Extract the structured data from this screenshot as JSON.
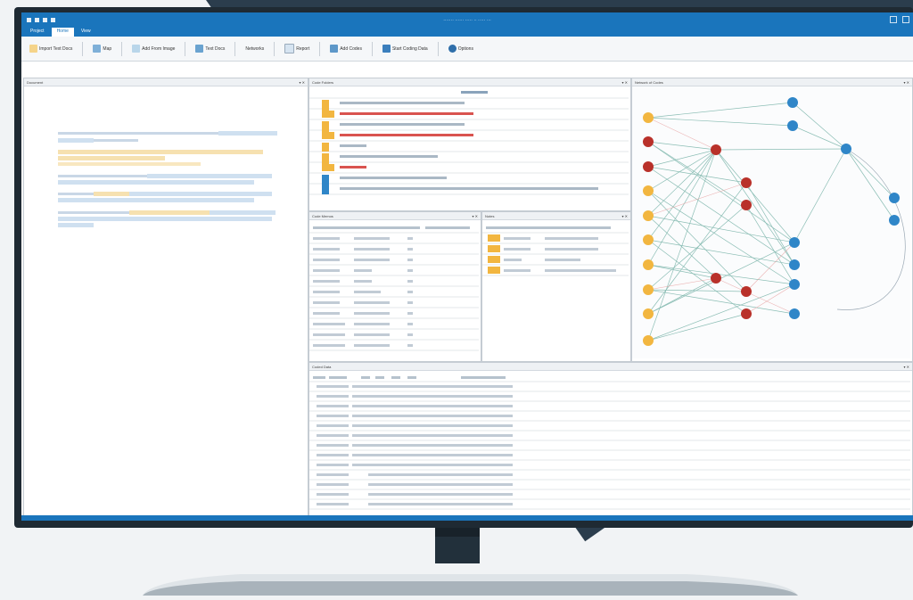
{
  "colors": {
    "accent": "#1a75bc",
    "node_yellow": "#f2b640",
    "node_red": "#b9312a",
    "node_blue": "#2f86c8",
    "highlight_blue": "#cfe0f0",
    "highlight_yellow": "#f6e1b0"
  },
  "window": {
    "title": "······· ······ ····· ·· ····· ···"
  },
  "menu": {
    "items": [
      "Project",
      "Home",
      "View"
    ]
  },
  "ribbon": {
    "buttons": [
      {
        "label": "Import Text Docs",
        "icon": "document-icon"
      },
      {
        "label": "Map",
        "icon": "map-icon"
      },
      {
        "label": "Add From Image",
        "icon": "image-icon"
      },
      {
        "label": "Text Docs",
        "icon": "docs-icon"
      },
      {
        "label": "Networks",
        "icon": "network-icon"
      },
      {
        "label": "Report",
        "icon": "report-icon"
      },
      {
        "label": "Add Codes",
        "icon": "code-icon"
      },
      {
        "label": "Start Coding Data",
        "icon": "start-icon"
      },
      {
        "label": "Options",
        "icon": "gear-icon"
      }
    ]
  },
  "panes": {
    "document": {
      "title": "Document"
    },
    "codes": {
      "title": "Code Folders"
    },
    "memos": {
      "title": "Code Memos"
    },
    "notes": {
      "title": "Notes"
    },
    "network": {
      "title": "Network of Codes"
    },
    "coded": {
      "title": "Coded Data"
    }
  }
}
